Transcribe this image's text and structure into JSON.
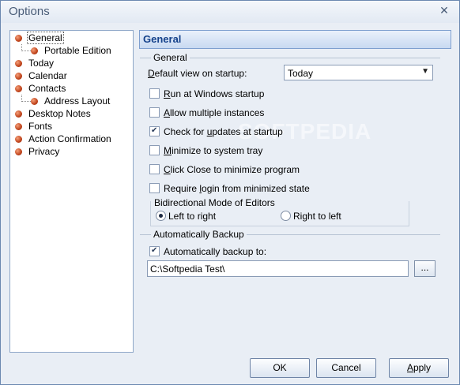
{
  "window": {
    "title": "Options",
    "close_glyph": "✕"
  },
  "tree": [
    {
      "label": "General",
      "selected": true
    },
    {
      "label": "Portable Edition",
      "child": true
    },
    {
      "label": "Today"
    },
    {
      "label": "Calendar"
    },
    {
      "label": "Contacts"
    },
    {
      "label": "Address Layout",
      "child": true
    },
    {
      "label": "Desktop Notes"
    },
    {
      "label": "Fonts"
    },
    {
      "label": "Action Confirmation"
    },
    {
      "label": "Privacy"
    }
  ],
  "panel": {
    "header": "General",
    "general_group": "General",
    "default_view": {
      "label_prefix": "",
      "label_u": "D",
      "label_rest": "efault view on startup:",
      "value": "Today"
    },
    "options": [
      {
        "pre": "",
        "u": "R",
        "post": "un at Windows startup",
        "checked": false
      },
      {
        "pre": "",
        "u": "A",
        "post": "llow multiple instances",
        "checked": false
      },
      {
        "pre": "Check for ",
        "u": "u",
        "post": "pdates at startup",
        "checked": true
      },
      {
        "pre": "",
        "u": "M",
        "post": "inimize to system tray",
        "checked": false
      },
      {
        "pre": "",
        "u": "C",
        "post": "lick Close to minimize program",
        "checked": false
      },
      {
        "pre": "Require ",
        "u": "l",
        "post": "ogin from minimized state",
        "checked": false
      }
    ],
    "bidi_group": "Bidirectional Mode of Editors",
    "bidi_options": [
      {
        "label": "Left to right",
        "checked": true
      },
      {
        "label": "Right to left",
        "checked": false
      }
    ],
    "backup_group": "Automatically Backup",
    "backup_checkbox": {
      "label": "Automatically backup to:",
      "checked": true
    },
    "backup_path": "C:\\Softpedia Test\\",
    "browse_label": "..."
  },
  "buttons": {
    "ok": "OK",
    "cancel": "Cancel",
    "apply_u": "A",
    "apply_rest": "pply"
  },
  "watermark": "SOFTPEDIA"
}
